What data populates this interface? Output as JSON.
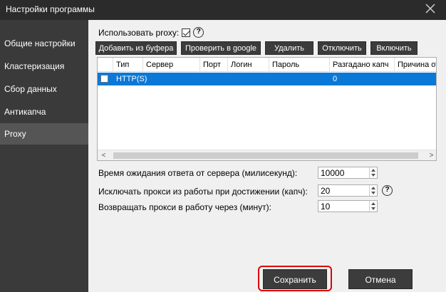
{
  "window": {
    "title": "Настройки программы",
    "close_icon": "close-icon"
  },
  "sidebar": {
    "items": [
      {
        "label": "Общие настройки",
        "active": false
      },
      {
        "label": "Кластеризация",
        "active": false
      },
      {
        "label": "Сбор данных",
        "active": false
      },
      {
        "label": "Антикапча",
        "active": false
      },
      {
        "label": "Proxy",
        "active": true
      }
    ]
  },
  "proxy": {
    "use_label": "Использовать proxy:",
    "use_checked": true,
    "help_glyph": "?",
    "toolbar": {
      "add_from_clipboard": "Добавить из буфера",
      "check_google": "Проверить в google",
      "delete": "Удалить",
      "disable": "Отключить",
      "enable": "Включить"
    },
    "table": {
      "columns": [
        "Тип",
        "Сервер",
        "Порт",
        "Логин",
        "Пароль",
        "Разгадано капч",
        "Причина откл"
      ],
      "rows": [
        {
          "type": "HTTP(S)",
          "server": "",
          "port": "",
          "login": "",
          "password": "",
          "solved": "0",
          "reason": ""
        }
      ],
      "scroll_left": "<",
      "scroll_right": ">"
    },
    "settings": [
      {
        "label": "Время ожидания ответа от сервера (милисекунд):",
        "value": "10000"
      },
      {
        "label": "Исключать прокси из работы при достижении (капч):",
        "value": "20"
      },
      {
        "label": "Возвращать прокси в работу через (минут):",
        "value": "10"
      }
    ]
  },
  "footer": {
    "save": "Сохранить",
    "cancel": "Отмена"
  },
  "colors": {
    "sidebar_bg": "#3a3a3a",
    "titlebar_bg": "#2b2b2b",
    "selection": "#0a78d7",
    "button_bg": "#3c3c3c",
    "highlight_outline": "#e00000"
  }
}
